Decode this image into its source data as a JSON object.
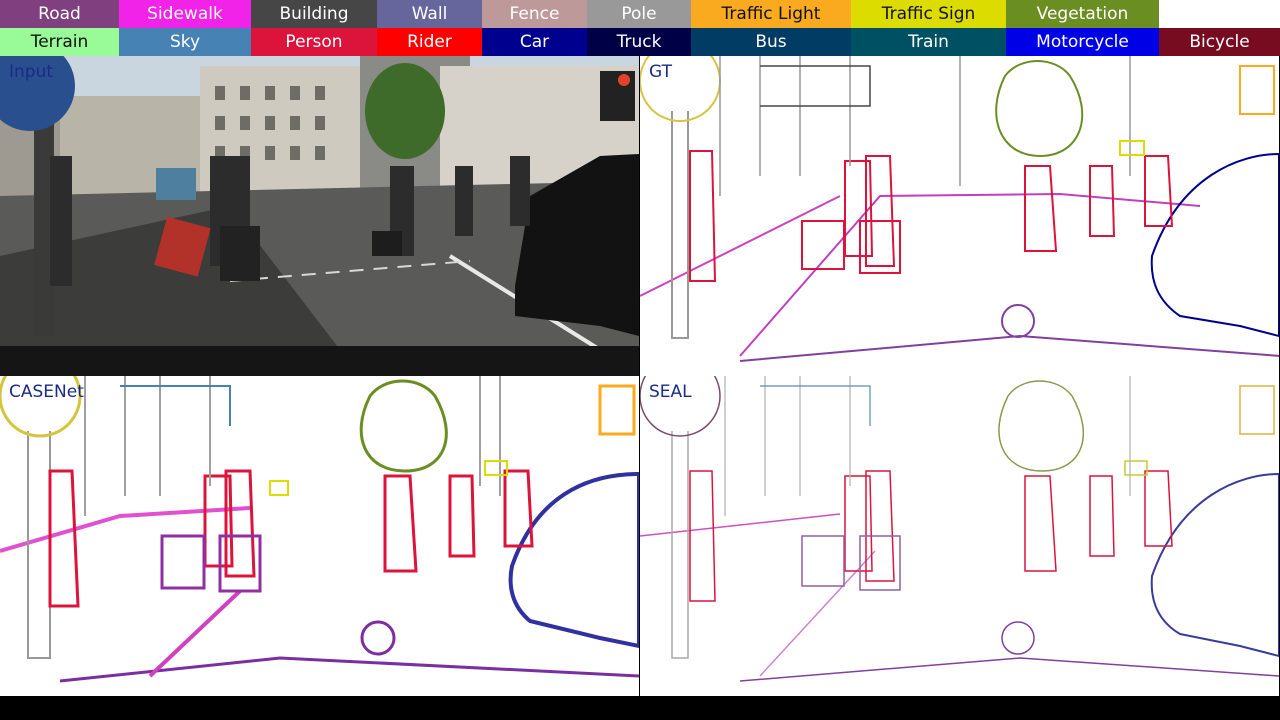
{
  "legend": {
    "row1": [
      {
        "label": "Road",
        "color": "#80407f"
      },
      {
        "label": "Sidewalk",
        "color": "#f223e8"
      },
      {
        "label": "Building",
        "color": "#464646"
      },
      {
        "label": "Wall",
        "color": "#66669c"
      },
      {
        "label": "Fence",
        "color": "#be9999"
      },
      {
        "label": "Pole",
        "color": "#999999"
      },
      {
        "label": "Traffic Light",
        "color": "#faaa1e"
      },
      {
        "label": "Traffic Sign",
        "color": "#dcdc00"
      },
      {
        "label": "Vegetation",
        "color": "#6b8e23"
      }
    ],
    "row2": [
      {
        "label": "Terrain",
        "color": "#98fb98"
      },
      {
        "label": "Sky",
        "color": "#4682b4"
      },
      {
        "label": "Person",
        "color": "#dc143c"
      },
      {
        "label": "Rider",
        "color": "#ff0000"
      },
      {
        "label": "Car",
        "color": "#00008e"
      },
      {
        "label": "Truck",
        "color": "#000046"
      },
      {
        "label": "Bus",
        "color": "#003c64"
      },
      {
        "label": "Train",
        "color": "#005064"
      },
      {
        "label": "Motorcycle",
        "color": "#0000e6"
      },
      {
        "label": "Bicycle",
        "color": "#770b20"
      }
    ]
  },
  "panels": {
    "input_label": "Input",
    "gt_label": "GT",
    "casenet_label": "CASENet",
    "seal_label": "SEAL"
  }
}
